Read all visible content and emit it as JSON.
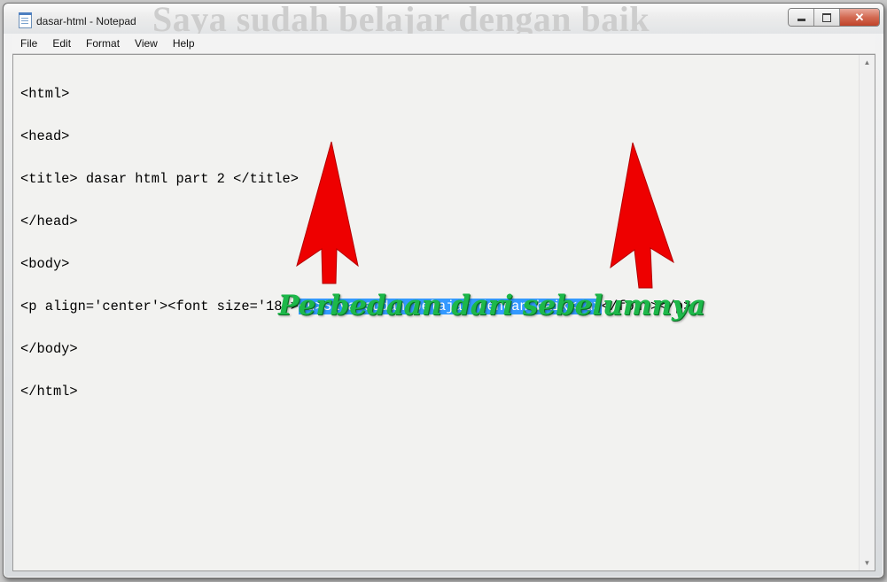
{
  "window": {
    "title": "dasar-html - Notepad",
    "background_ghost_text": "Saya sudah belajar dengan baik"
  },
  "caption_buttons": {
    "minimize_icon": "minimize-icon",
    "maximize_icon": "restore-icon",
    "close_label": "✕"
  },
  "menu": {
    "items": [
      "File",
      "Edit",
      "Format",
      "View",
      "Help"
    ]
  },
  "editor": {
    "lines": [
      "<html>",
      "<head>",
      "<title> dasar html part 2 </title>",
      "</head>",
      "<body>",
      "",
      "</body>",
      "</html>"
    ],
    "line6_before": "<p align='center'><font size='18'>",
    "line6_selected": "<u>Saya sudah belajar dengan baik</u>",
    "line6_after": "</font></p>",
    "selection_color": "#3399ff"
  },
  "annotation": {
    "text": "Perbedaan dari sebelumnya",
    "color": "#1db84a",
    "arrow_color": "#ee0000"
  }
}
